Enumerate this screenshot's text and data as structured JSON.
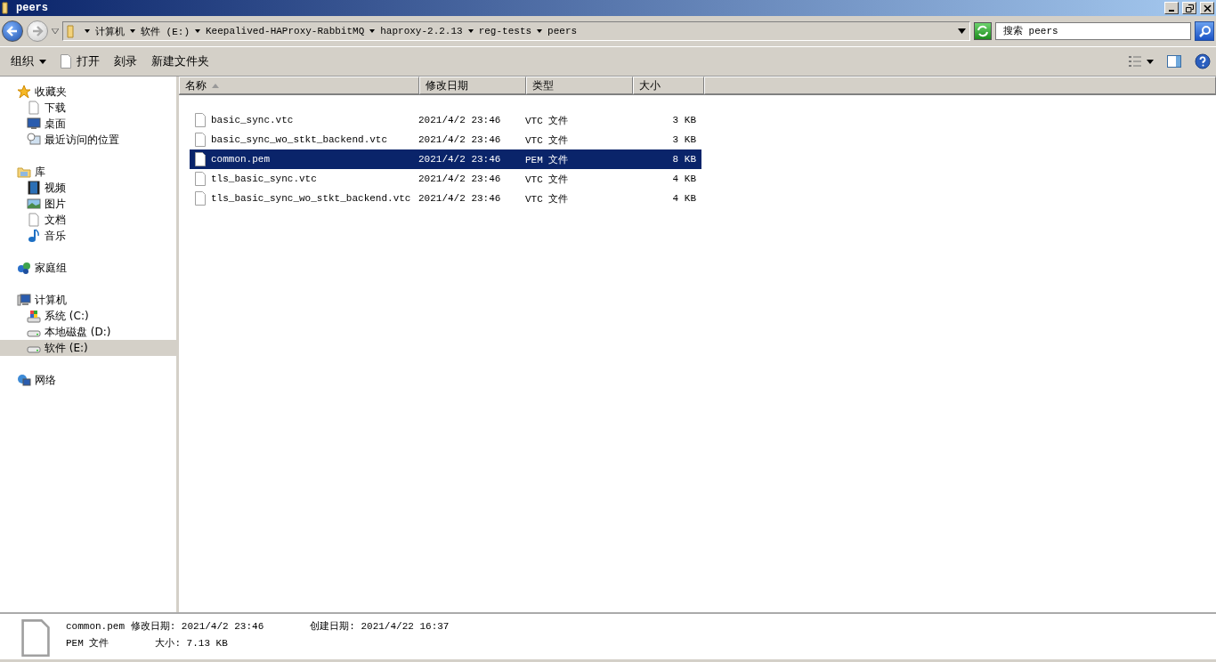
{
  "window": {
    "title": "peers"
  },
  "address_bar": {
    "segments": [
      "计算机",
      "软件 (E:)",
      "Keepalived-HAProxy-RabbitMQ",
      "haproxy-2.2.13",
      "reg-tests",
      "peers"
    ]
  },
  "search": {
    "placeholder": "搜索 peers"
  },
  "toolbar": {
    "buttons": [
      {
        "label": "组织",
        "kind": "menu"
      },
      {
        "label": "打开",
        "kind": "open"
      },
      {
        "label": "刻录",
        "kind": "plain"
      },
      {
        "label": "新建文件夹",
        "kind": "plain"
      }
    ]
  },
  "sidebar": {
    "groups": [
      {
        "label": "收藏夹",
        "kind": "star",
        "selected": false,
        "children": [
          {
            "label": "下载",
            "kind": "document",
            "selected": false
          },
          {
            "label": "桌面",
            "kind": "desktop",
            "selected": false
          },
          {
            "label": "最近访问的位置",
            "kind": "recent",
            "selected": false
          }
        ]
      },
      {
        "label": "库",
        "kind": "library",
        "selected": false,
        "children": [
          {
            "label": "视频",
            "kind": "video",
            "selected": false
          },
          {
            "label": "图片",
            "kind": "picture",
            "selected": false
          },
          {
            "label": "文档",
            "kind": "document",
            "selected": false
          },
          {
            "label": "音乐",
            "kind": "music",
            "selected": false
          }
        ]
      },
      {
        "label": "家庭组",
        "kind": "homegroup",
        "selected": false
      },
      {
        "label": "计算机",
        "kind": "computer",
        "selected": false,
        "children": [
          {
            "label": "系统 (C:)",
            "kind": "system-drive",
            "selected": false
          },
          {
            "label": "本地磁盘 (D:)",
            "kind": "drive",
            "selected": false
          },
          {
            "label": "软件 (E:)",
            "kind": "drive",
            "selected": true
          }
        ]
      },
      {
        "label": "网络",
        "kind": "network",
        "selected": false
      }
    ]
  },
  "table": {
    "columns": [
      {
        "label": "名称",
        "sorted": true
      },
      {
        "label": "修改日期",
        "sorted": false
      },
      {
        "label": "类型",
        "sorted": false
      },
      {
        "label": "大小",
        "sorted": false
      }
    ],
    "rows": [
      {
        "name": "basic_sync.vtc",
        "modified": "2021/4/2 23:46",
        "type": "VTC 文件",
        "size": "3 KB",
        "selected": false
      },
      {
        "name": "basic_sync_wo_stkt_backend.vtc",
        "modified": "2021/4/2 23:46",
        "type": "VTC 文件",
        "size": "3 KB",
        "selected": false
      },
      {
        "name": "common.pem",
        "modified": "2021/4/2 23:46",
        "type": "PEM 文件",
        "size": "8 KB",
        "selected": true
      },
      {
        "name": "tls_basic_sync.vtc",
        "modified": "2021/4/2 23:46",
        "type": "VTC 文件",
        "size": "4 KB",
        "selected": false
      },
      {
        "name": "tls_basic_sync_wo_stkt_backend.vtc",
        "modified": "2021/4/2 23:46",
        "type": "VTC 文件",
        "size": "4 KB",
        "selected": false
      }
    ]
  },
  "details_pane": {
    "name": "common.pem",
    "modified": "修改日期: 2021/4/2 23:46",
    "created": "创建日期: 2021/4/22 16:37",
    "type": "PEM 文件",
    "size": "大小: 7.13 KB"
  }
}
